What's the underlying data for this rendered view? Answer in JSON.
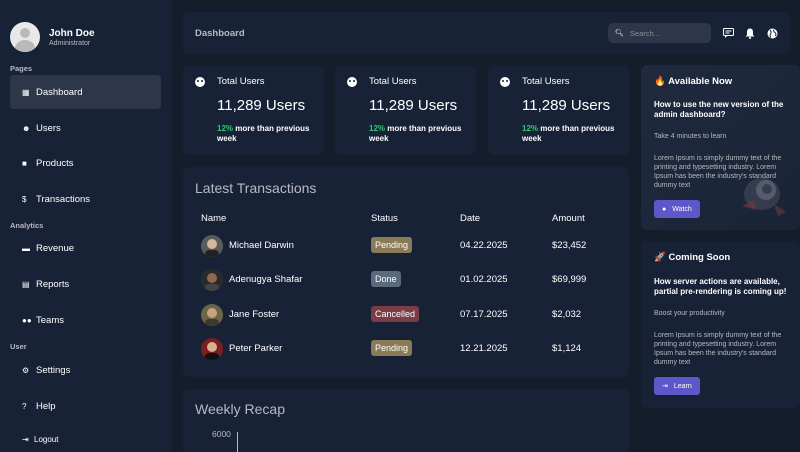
{
  "user": {
    "name": "John Doe",
    "role": "Administrator"
  },
  "sidebar": {
    "sections": [
      "Pages",
      "Analytics",
      "User"
    ],
    "items": [
      {
        "label": "Dashboard",
        "icon": "grid-icon"
      },
      {
        "label": "Users",
        "icon": "users-icon"
      },
      {
        "label": "Products",
        "icon": "shopping-bag-icon"
      },
      {
        "label": "Transactions",
        "icon": "dollar-icon"
      },
      {
        "label": "Revenue",
        "icon": "briefcase-icon"
      },
      {
        "label": "Reports",
        "icon": "chart-icon"
      },
      {
        "label": "Teams",
        "icon": "team-icon"
      },
      {
        "label": "Settings",
        "icon": "gear-icon"
      },
      {
        "label": "Help",
        "icon": "help-icon"
      }
    ],
    "logout": "Logout"
  },
  "topbar": {
    "title": "Dashboard",
    "search_placeholder": "Search..."
  },
  "stats": [
    {
      "title": "Total Users",
      "value": "11,289 Users",
      "pct": "12%",
      "detail": "more than previous week"
    },
    {
      "title": "Total Users",
      "value": "11,289 Users",
      "pct": "12%",
      "detail": "more than previous week"
    },
    {
      "title": "Total Users",
      "value": "11,289 Users",
      "pct": "12%",
      "detail": "more than previous week"
    }
  ],
  "transactions": {
    "title": "Latest Transactions",
    "columns": [
      "Name",
      "Status",
      "Date",
      "Amount"
    ],
    "rows": [
      {
        "name": "Michael Darwin",
        "status": "Pending",
        "date": "04.22.2025",
        "amount": "$23,452"
      },
      {
        "name": "Adenugya Shafar",
        "status": "Done",
        "date": "01.02.2025",
        "amount": "$69,999"
      },
      {
        "name": "Jane Foster",
        "status": "Cancelled",
        "date": "07.17.2025",
        "amount": "$2,032"
      },
      {
        "name": "Peter Parker",
        "status": "Pending",
        "date": "12.21.2025",
        "amount": "$1,124"
      }
    ]
  },
  "weekly": {
    "title": "Weekly Recap",
    "tick": "6000"
  },
  "promos": [
    {
      "head": "🔥 Available Now",
      "question": "How to use the new version of the admin dashboard?",
      "sub": "Take 4 minutes to learn",
      "body": "Lorem Ipsum is simply dummy text of the printing and typesetting industry. Lorem Ipsum has been the industry's standard dummy text",
      "button": "Watch"
    },
    {
      "head": "🚀 Coming Soon",
      "question": "How server actions are available, partial pre-rendering is coming up!",
      "sub": "Boost your productivity",
      "body": "Lorem Ipsum is simply dummy text of the printing and typesetting industry. Lorem Ipsum has been the industry's standard dummy text",
      "button": "Learn"
    }
  ],
  "colors": {
    "background": "#151c2c",
    "card": "#182237",
    "active": "#2e374a",
    "accent": "#5d57c9",
    "positive": "#2ecc71",
    "pending": "#8a7a55",
    "done": "#5a6a7c",
    "cancelled": "#7a3d45"
  }
}
